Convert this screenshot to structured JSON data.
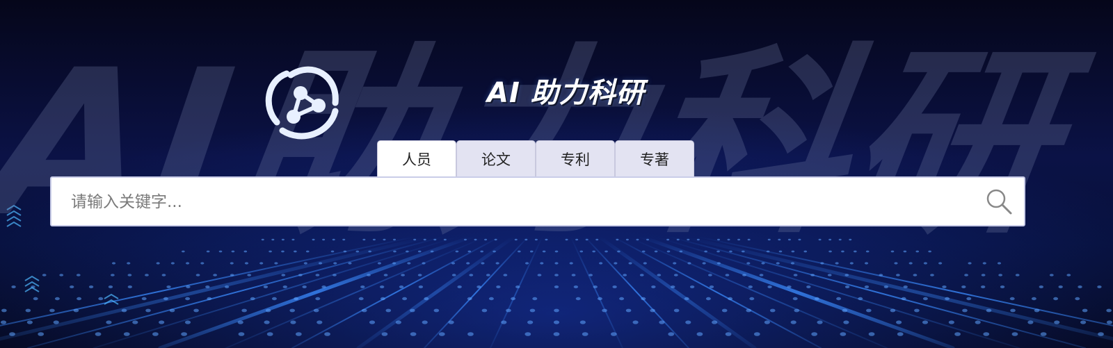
{
  "header": {
    "title": "AI 助力科研",
    "watermark": "AI助力科研",
    "logo_icon": "atom-orbit-logo-icon"
  },
  "tabs": [
    {
      "label": "人员",
      "active": true
    },
    {
      "label": "论文",
      "active": false
    },
    {
      "label": "专利",
      "active": false
    },
    {
      "label": "专著",
      "active": false
    }
  ],
  "search": {
    "placeholder": "请输入关键字...",
    "value": "",
    "icon": "search-icon"
  },
  "colors": {
    "background": "#06081e",
    "glow": "#2f7dff",
    "tab_active": "#ffffff",
    "tab_inactive": "#e3e3f2"
  }
}
